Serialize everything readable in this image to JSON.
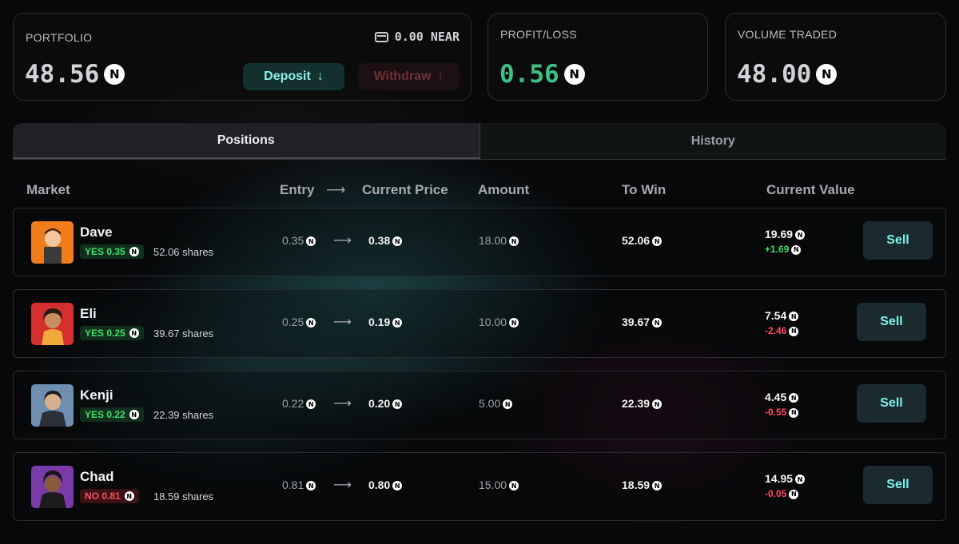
{
  "portfolio": {
    "label": "PORTFOLIO",
    "value": "48.56",
    "balance": "0.00 NEAR",
    "deposit_label": "Deposit",
    "withdraw_label": "Withdraw"
  },
  "profit_loss": {
    "label": "PROFIT/LOSS",
    "value": "0.56"
  },
  "volume": {
    "label": "VOLUME TRADED",
    "value": "48.00"
  },
  "tabs": [
    {
      "label": "Positions",
      "active": true
    },
    {
      "label": "History",
      "active": false
    }
  ],
  "columns": {
    "market": "Market",
    "entry": "Entry",
    "current_price": "Current Price",
    "amount": "Amount",
    "to_win": "To Win",
    "current_value": "Current Value"
  },
  "near_symbol": "N",
  "arrow": "⟶",
  "positions": [
    {
      "name": "Dave",
      "side": "YES 0.35",
      "shares": "52.06 shares",
      "entry": "0.35",
      "current": "0.38",
      "amount": "18.00",
      "to_win": "52.06",
      "value": "19.69",
      "change": "+1.69",
      "sell_label": "Sell"
    },
    {
      "name": "Eli",
      "side": "YES 0.25",
      "shares": "39.67 shares",
      "entry": "0.25",
      "current": "0.19",
      "amount": "10.00",
      "to_win": "39.67",
      "value": "7.54",
      "change": "-2.46",
      "sell_label": "Sell"
    },
    {
      "name": "Kenji",
      "side": "YES 0.22",
      "shares": "22.39 shares",
      "entry": "0.22",
      "current": "0.20",
      "amount": "5.00",
      "to_win": "22.39",
      "value": "4.45",
      "change": "-0.55",
      "sell_label": "Sell"
    },
    {
      "name": "Chad",
      "side": "NO 0.81",
      "shares": "18.59 shares",
      "entry": "0.81",
      "current": "0.80",
      "amount": "15.00",
      "to_win": "18.59",
      "value": "14.95",
      "change": "-0.05",
      "sell_label": "Sell"
    }
  ],
  "colors": {
    "positive": "#3ee068",
    "negative": "#ff4d5a",
    "accent": "#8ef0e6"
  }
}
